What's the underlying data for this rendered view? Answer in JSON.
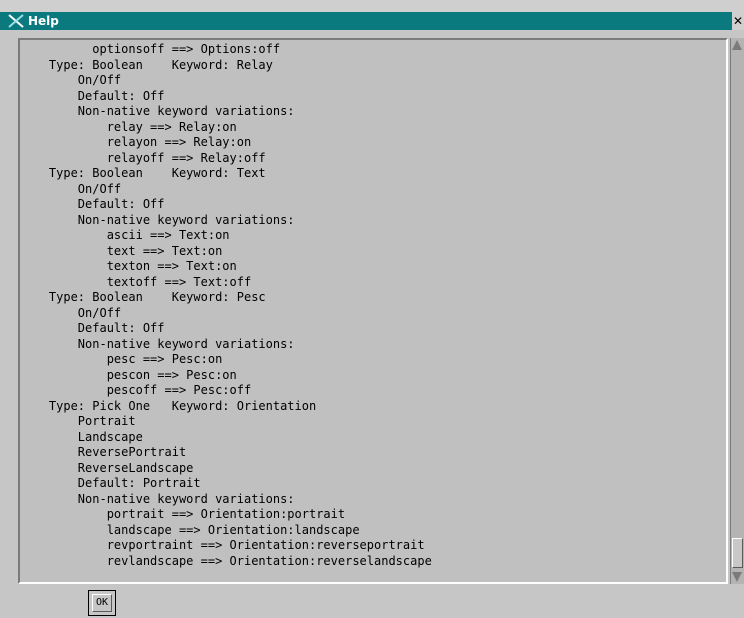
{
  "window": {
    "title": "Help",
    "icon": "x-app-icon",
    "close_label": "✕",
    "colors": {
      "titlebar": "#0b7a7f",
      "background": "#c6c6c6"
    }
  },
  "help_text": {
    "lines": [
      "          optionsoff ==> Options:off",
      "    Type: Boolean    Keyword: Relay",
      "        On/Off",
      "        Default: Off",
      "        Non-native keyword variations:",
      "            relay ==> Relay:on",
      "            relayon ==> Relay:on",
      "            relayoff ==> Relay:off",
      "    Type: Boolean    Keyword: Text",
      "        On/Off",
      "        Default: Off",
      "        Non-native keyword variations:",
      "            ascii ==> Text:on",
      "            text ==> Text:on",
      "            texton ==> Text:on",
      "            textoff ==> Text:off",
      "    Type: Boolean    Keyword: Pesc",
      "        On/Off",
      "        Default: Off",
      "        Non-native keyword variations:",
      "            pesc ==> Pesc:on",
      "            pescon ==> Pesc:on",
      "            pescoff ==> Pesc:off",
      "    Type: Pick One   Keyword: Orientation",
      "        Portrait",
      "        Landscape",
      "        ReversePortrait",
      "        ReverseLandscape",
      "        Default: Portrait",
      "        Non-native keyword variations:",
      "            portrait ==> Orientation:portrait",
      "            landscape ==> Orientation:landscape",
      "            revportraint ==> Orientation:reverseportrait",
      "            revlandscape ==> Orientation:reverselandscape"
    ]
  },
  "buttons": {
    "ok_label": "OK"
  },
  "scrollbar": {
    "position": "bottom"
  }
}
